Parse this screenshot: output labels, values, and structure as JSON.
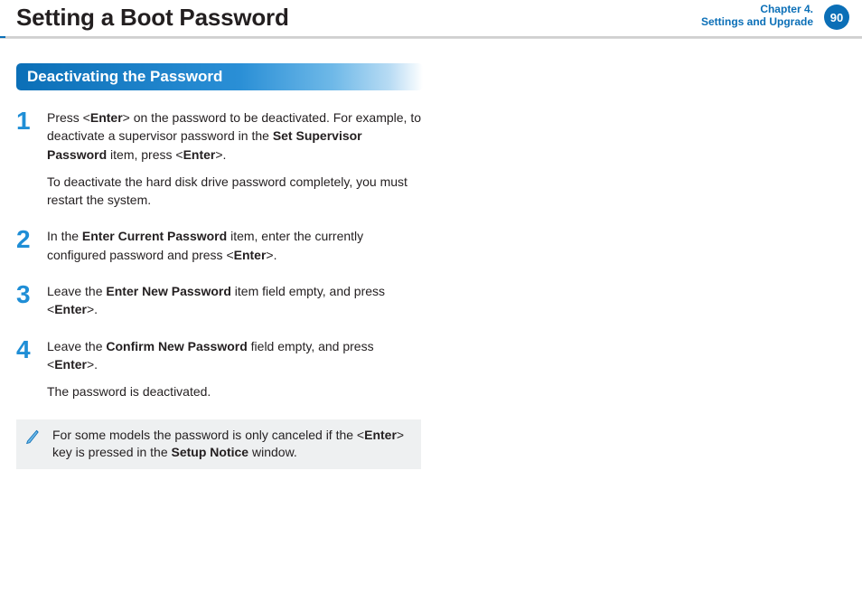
{
  "header": {
    "title": "Setting a Boot Password",
    "chapter_line1": "Chapter 4.",
    "chapter_line2": "Settings and Upgrade",
    "page_number": "90"
  },
  "section": {
    "title": "Deactivating the Password"
  },
  "steps": [
    {
      "num": "1",
      "paras": [
        "Press <<b>Enter</b>> on the password to be deactivated. For example, to deactivate a supervisor password in the <b>Set Supervisor Password</b> item, press <<b>Enter</b>>.",
        "To deactivate the hard disk drive password completely, you must restart the system."
      ]
    },
    {
      "num": "2",
      "paras": [
        "In the <b>Enter Current Password</b> item, enter the currently configured password and press <<b>Enter</b>>."
      ]
    },
    {
      "num": "3",
      "paras": [
        "Leave the <b>Enter New Password</b> item field empty, and press <<b>Enter</b>>."
      ]
    },
    {
      "num": "4",
      "paras": [
        "Leave the <b>Confirm New Password</b> field empty, and press <<b>Enter</b>>.",
        "The password is deactivated."
      ]
    }
  ],
  "note": {
    "text": "For some models the password is only canceled if the <<b>Enter</b>> key is pressed in the <b>Setup Notice</b> window."
  }
}
